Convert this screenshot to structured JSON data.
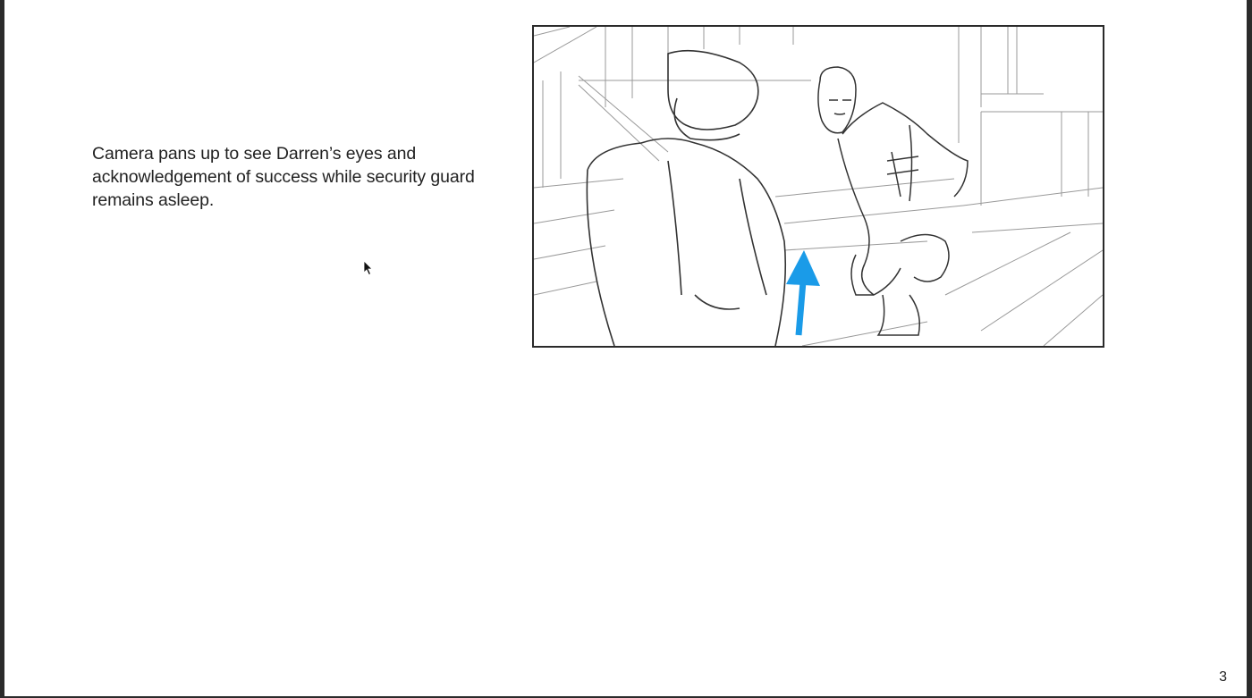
{
  "slide": {
    "caption": "Camera pans up to see Darren’s eyes and acknowledgement of success while security guard remains asleep.",
    "page_number": "3"
  },
  "storyboard_frame": {
    "description_icon": "sketch-storyboard-image",
    "arrow_icon": "camera-pan-up-arrow-icon",
    "arrow_color": "#1a9be8"
  },
  "cursor_icon": "mouse-pointer-icon"
}
